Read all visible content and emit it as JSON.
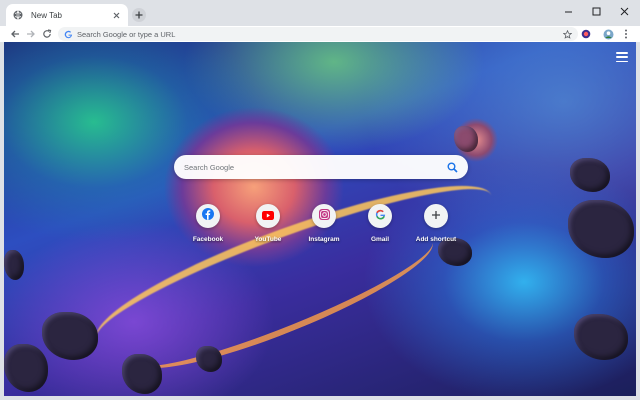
{
  "tabs": [
    {
      "title": "New Tab",
      "favicon": "globe-icon"
    }
  ],
  "toolbar": {
    "omnibox_placeholder": "Search Google or type a URL"
  },
  "ntp": {
    "search_placeholder": "Search Google",
    "shortcuts": [
      {
        "label": "Facebook",
        "icon": "facebook-icon",
        "color": "#1877f2"
      },
      {
        "label": "YouTube",
        "icon": "youtube-icon",
        "color": "#ff0000"
      },
      {
        "label": "Instagram",
        "icon": "instagram-icon",
        "color": "#c13584"
      },
      {
        "label": "Gmail",
        "icon": "google-icon",
        "color": "#4285f4"
      },
      {
        "label": "Add shortcut",
        "icon": "plus-icon",
        "color": "#3c4043"
      }
    ]
  },
  "colors": {
    "chrome_bg": "#dee1e6",
    "accent_blue": "#1a73e8"
  }
}
